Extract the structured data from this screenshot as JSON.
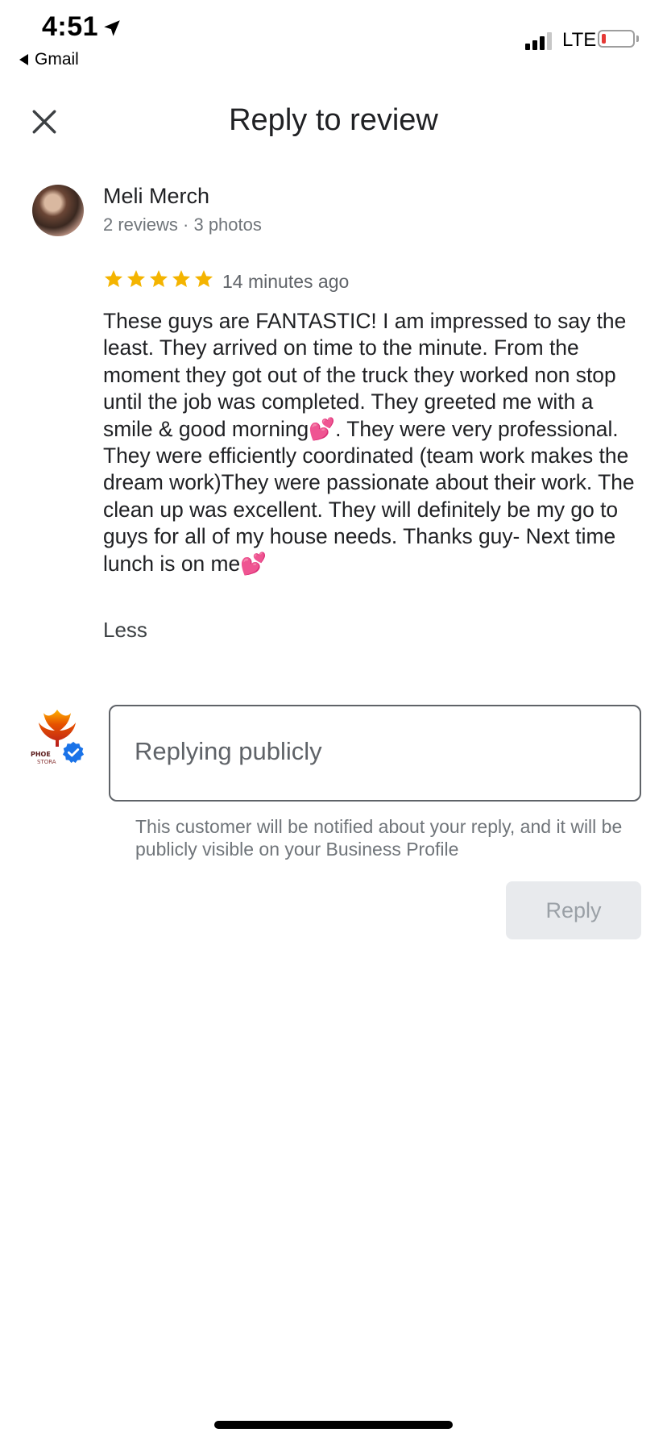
{
  "status_bar": {
    "time": "4:51",
    "back_app": "Gmail",
    "network": "LTE",
    "battery_level": 0.15
  },
  "header": {
    "title": "Reply to review"
  },
  "review": {
    "reviewer_name": "Meli Merch",
    "reviewer_meta": "2 reviews · 3 photos",
    "rating": 5,
    "time_ago": "14 minutes ago",
    "text": "These guys are FANTASTIC! I am impressed to say the least. They arrived on time to the minute. From the moment they got out of the truck they worked non stop until the job was completed. They greeted me with a smile & good morning💕. They were very professional. They were efficiently coordinated (team work makes the dream work)They were passionate about their work. The clean up was excellent. They will definitely be my go to guys for all of my house needs. Thanks guy- Next time lunch is on me💕",
    "less_label": "Less"
  },
  "reply": {
    "business_logo_text": "PHOENIX RESTORATION",
    "placeholder": "Replying publicly",
    "value": "",
    "helper_text": "This customer will be notified about your reply, and it will be publicly visible on your Business Profile",
    "button_label": "Reply"
  },
  "colors": {
    "star": "#f4b400",
    "verified": "#1a73e8",
    "button_bg": "#e8eaed",
    "button_text": "#9aa0a6",
    "battery_low": "#e53935"
  },
  "icons": {
    "close": "close-icon",
    "location": "location-arrow-icon",
    "verified": "verified-badge-icon",
    "star": "star-icon"
  }
}
